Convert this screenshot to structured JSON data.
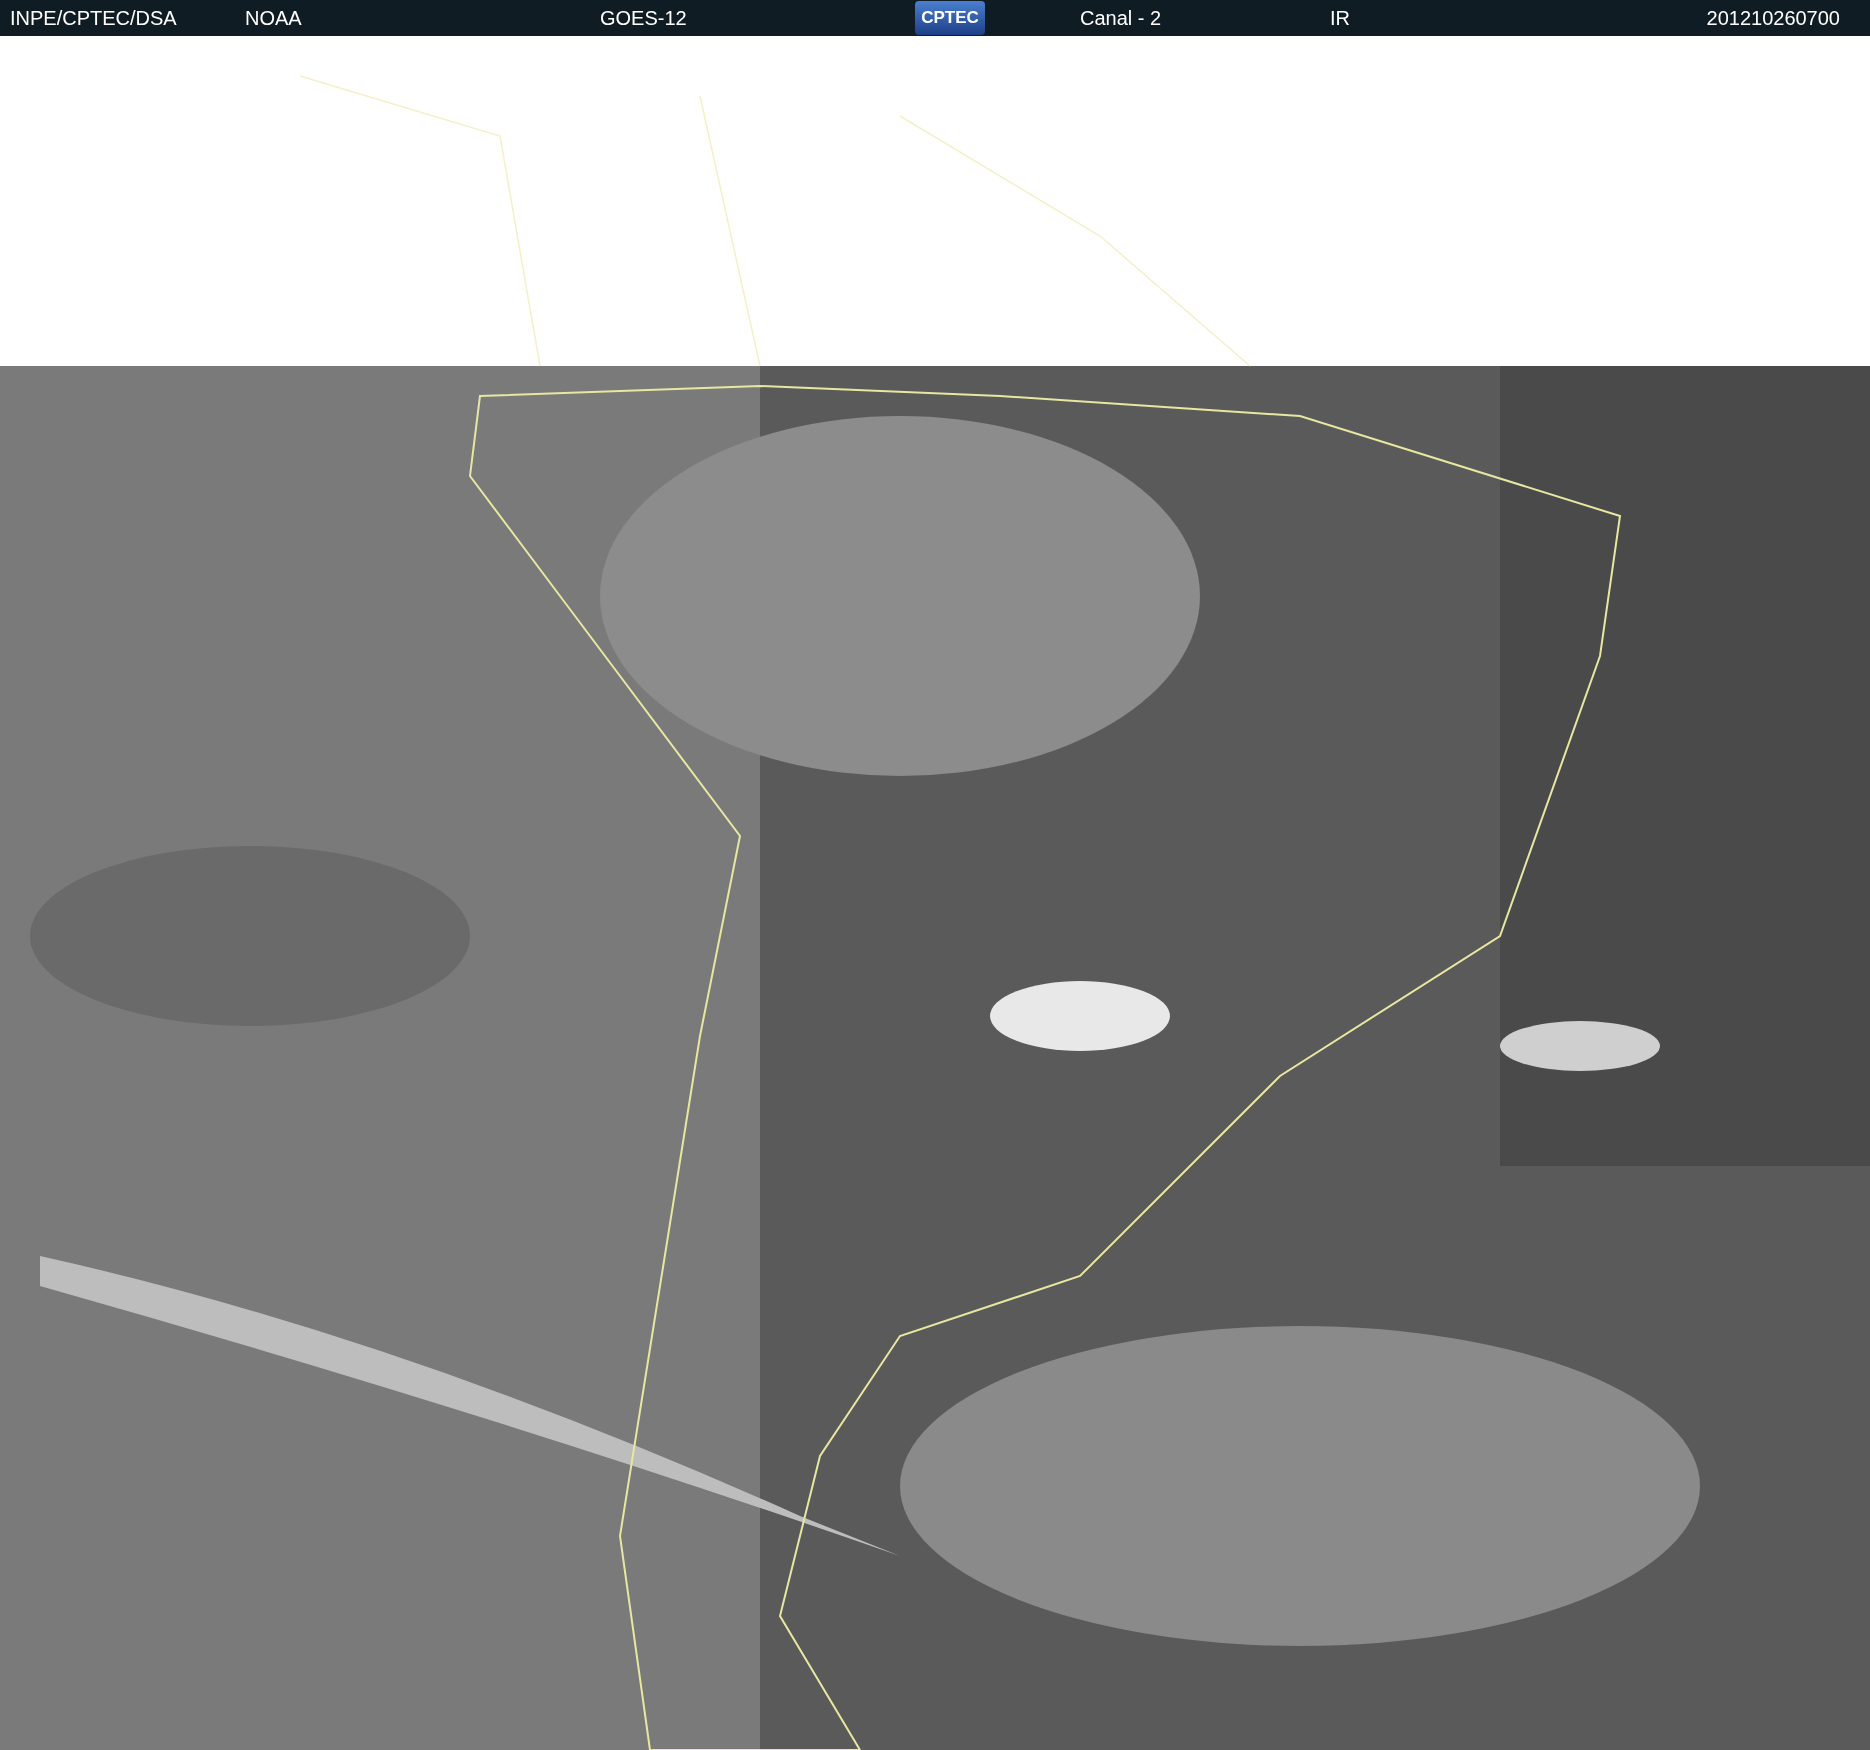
{
  "header": {
    "items": [
      {
        "kind": "text",
        "text": "INPE/CPTEC/DSA"
      },
      {
        "kind": "text",
        "text": "NOAA"
      },
      {
        "kind": "text",
        "text": "GOES-12"
      },
      {
        "kind": "logo",
        "text": "CPTEC"
      },
      {
        "kind": "text",
        "text": "Canal - 2"
      },
      {
        "kind": "text",
        "text": "IR"
      },
      {
        "kind": "text",
        "text": "201210260700"
      }
    ]
  }
}
